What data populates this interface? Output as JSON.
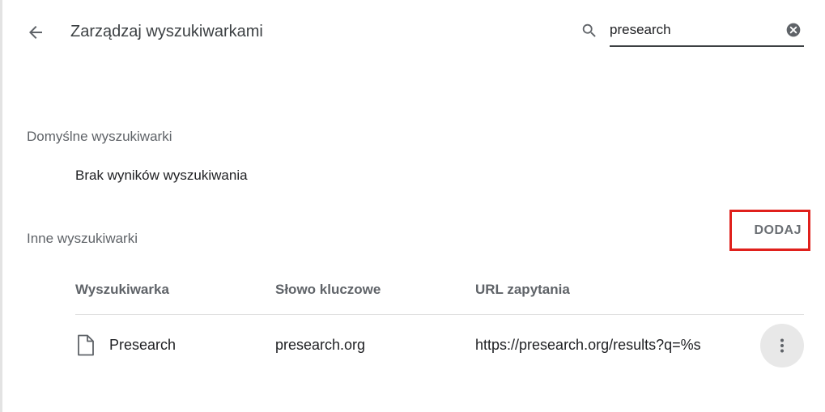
{
  "header": {
    "title": "Zarządzaj wyszukiwarkami",
    "back_icon": "arrow-back-icon"
  },
  "search": {
    "value": "presearch",
    "placeholder": "",
    "search_icon": "search-icon",
    "clear_icon": "clear-icon"
  },
  "default_engines": {
    "heading": "Domyślne wyszukiwarki",
    "empty_message": "Brak wyników wyszukiwania"
  },
  "other_engines": {
    "heading": "Inne wyszukiwarki",
    "add_label": "DODAJ",
    "highlight_color": "#e0201c",
    "columns": [
      "Wyszukiwarka",
      "Słowo kluczowe",
      "URL zapytania"
    ],
    "rows": [
      {
        "icon": "file-icon",
        "name": "Presearch",
        "keyword": "presearch.org",
        "url": "https://presearch.org/results?q=%s"
      }
    ]
  }
}
